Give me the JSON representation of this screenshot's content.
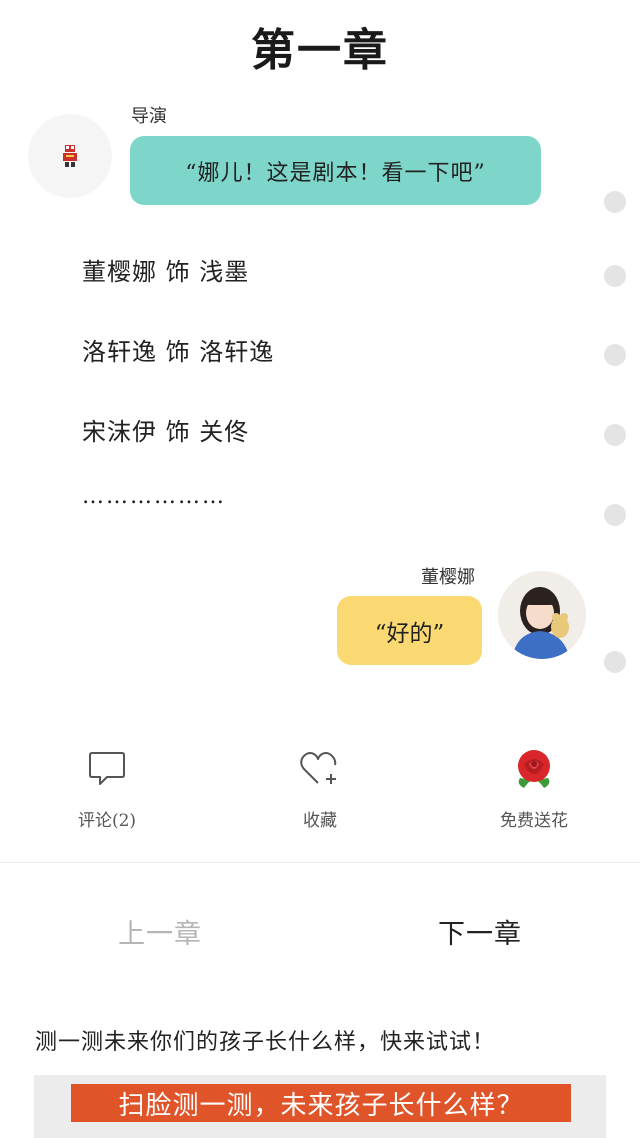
{
  "chapter": {
    "title": "第一章"
  },
  "director": {
    "name": "导演",
    "message": "“娜儿！这是剧本！看一下吧”"
  },
  "cast": [
    {
      "line": "董樱娜 饰 浅墨"
    },
    {
      "line": "洛轩逸 饰 洛轩逸"
    },
    {
      "line": "宋沫伊 饰 关佟"
    }
  ],
  "cast_ellipsis": "………………",
  "user": {
    "name": "董樱娜",
    "message": "“好的”"
  },
  "actions": {
    "comment_label": "评论(2)",
    "favorite_label": "收藏",
    "flower_label": "免费送花"
  },
  "nav": {
    "prev_label": "上一章",
    "next_label": "下一章"
  },
  "promo": {
    "text": "测一测未来你们的孩子长什么样，快来试试！",
    "banner": "扫脸测一测，未来孩子长什么样？"
  },
  "colors": {
    "teal_bubble": "#7ed6cb",
    "yellow_bubble": "#fad972",
    "banner": "#e0542a"
  }
}
